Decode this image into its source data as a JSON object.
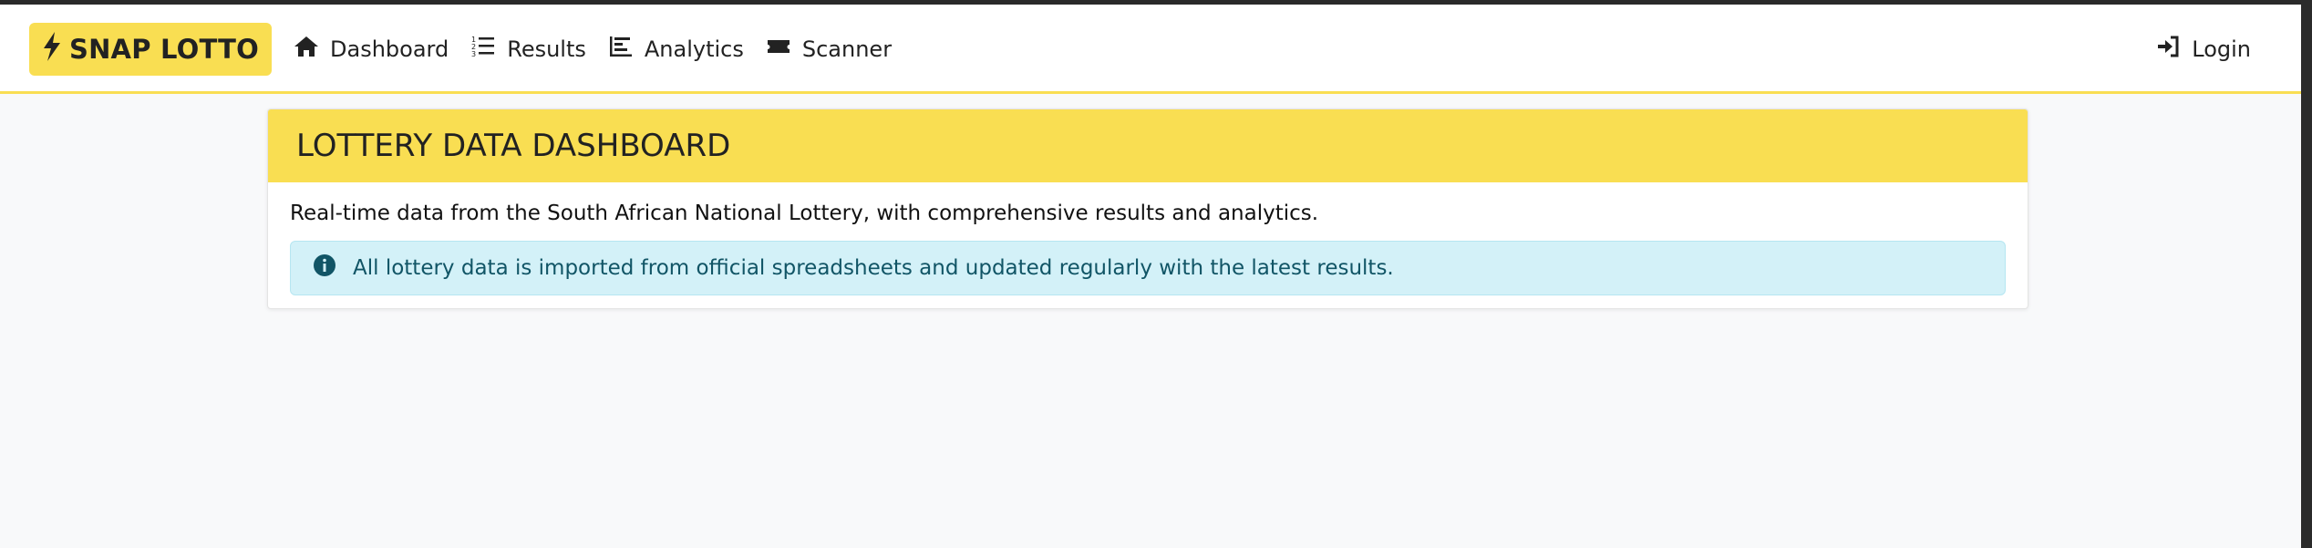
{
  "navbar": {
    "brand": "SNAP LOTTO",
    "items": [
      {
        "label": "Dashboard",
        "icon": "home-icon"
      },
      {
        "label": "Results",
        "icon": "ordered-list-icon"
      },
      {
        "label": "Analytics",
        "icon": "chart-icon"
      },
      {
        "label": "Scanner",
        "icon": "ticket-icon"
      }
    ],
    "login": "Login"
  },
  "card": {
    "title": "LOTTERY DATA DASHBOARD",
    "lead": "Real-time data from the South African National Lottery, with comprehensive results and analytics.",
    "info": "All lottery data is imported from official spreadsheets and updated regularly with the latest results."
  },
  "colors": {
    "accent": "#f9de52",
    "info_bg": "#d3f1f8",
    "info_text": "#115566",
    "page_bg": "#f8f9fa"
  }
}
